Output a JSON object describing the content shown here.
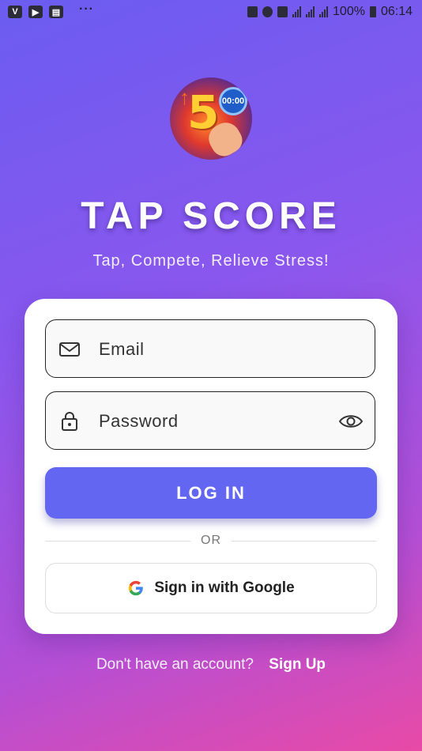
{
  "status_bar": {
    "battery": "100%",
    "time": "06:14"
  },
  "app": {
    "logo_timer": "00:00",
    "logo_number": "5",
    "title": "TAP SCORE",
    "subtitle": "Tap, Compete, Relieve Stress!"
  },
  "form": {
    "email_placeholder": "Email",
    "password_placeholder": "Password",
    "login_label": "LOG IN",
    "divider_label": "OR",
    "google_label": "Sign in with Google"
  },
  "footer": {
    "prompt": "Don't have an account?",
    "signup_label": "Sign Up"
  },
  "colors": {
    "primary": "#6366f1",
    "gradient_top": "#6b5cf0",
    "gradient_bottom": "#e84aa6"
  }
}
